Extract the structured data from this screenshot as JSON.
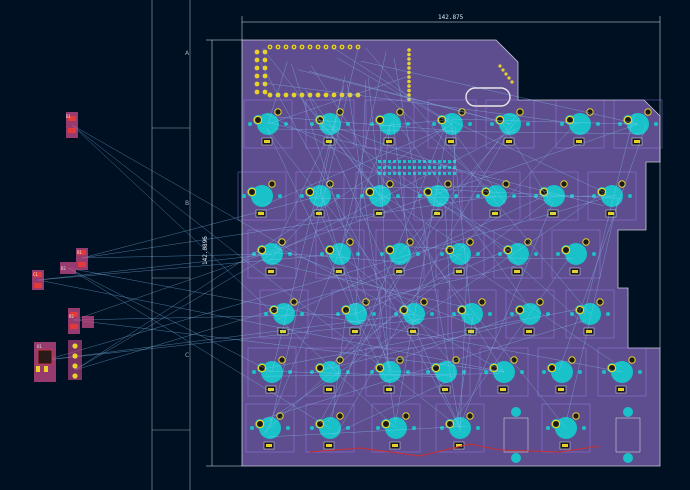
{
  "board": {
    "width_dim_label": "142.875",
    "height_dim_label": "142.0896"
  },
  "sheet": {
    "zone_labels": [
      "A",
      "B",
      "C"
    ]
  },
  "footprint_refs": [
    "D1",
    "R1",
    "D2",
    "C1",
    "R2",
    "U1"
  ],
  "colors": {
    "background": "#001023",
    "board_fill": "#5e4e90",
    "board_edge": "#c8c8d0",
    "ratsnest": "#8fd0ff",
    "pad_cyan": "#19c2c9",
    "silk_yellow": "#e8d22a",
    "courtyard": "#b08cff",
    "trace_red": "#c83030",
    "sheet_frame": "#b0b0b0"
  }
}
